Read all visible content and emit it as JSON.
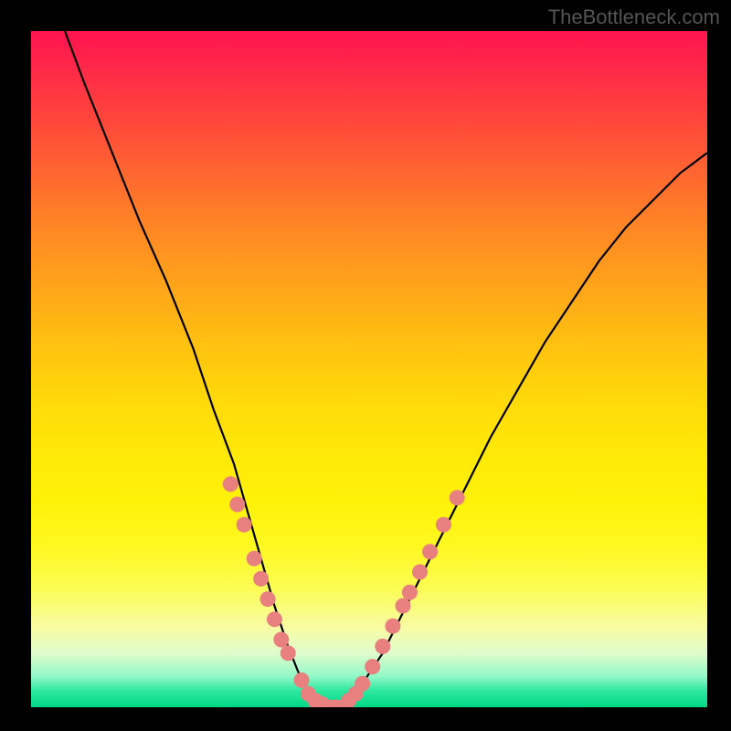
{
  "watermark": "TheBottleneck.com",
  "chart_data": {
    "type": "line",
    "title": "",
    "xlabel": "",
    "ylabel": "",
    "xlim": [
      0,
      100
    ],
    "ylim": [
      0,
      100
    ],
    "curve": {
      "name": "bottleneck-curve",
      "x": [
        5,
        8,
        12,
        16,
        20,
        24,
        27,
        30,
        32,
        34,
        36,
        38,
        40,
        42,
        44,
        46,
        48,
        52,
        56,
        60,
        64,
        68,
        72,
        76,
        80,
        84,
        88,
        92,
        96,
        100
      ],
      "y": [
        100,
        92,
        82,
        72,
        63,
        53,
        44,
        36,
        29,
        22,
        15,
        9,
        4,
        1,
        0,
        0,
        2,
        8,
        16,
        24,
        32,
        40,
        47,
        54,
        60,
        66,
        71,
        75,
        79,
        82
      ]
    },
    "dots": {
      "name": "highlighted-points",
      "color": "#e98080",
      "points": [
        {
          "x": 29.5,
          "y": 33
        },
        {
          "x": 30.5,
          "y": 30
        },
        {
          "x": 31.5,
          "y": 27
        },
        {
          "x": 33,
          "y": 22
        },
        {
          "x": 34,
          "y": 19
        },
        {
          "x": 35,
          "y": 16
        },
        {
          "x": 36,
          "y": 13
        },
        {
          "x": 37,
          "y": 10
        },
        {
          "x": 38,
          "y": 8
        },
        {
          "x": 40,
          "y": 4
        },
        {
          "x": 41,
          "y": 2
        },
        {
          "x": 42,
          "y": 1
        },
        {
          "x": 43,
          "y": 0.5
        },
        {
          "x": 44,
          "y": 0
        },
        {
          "x": 45,
          "y": 0
        },
        {
          "x": 46,
          "y": 0
        },
        {
          "x": 47,
          "y": 1
        },
        {
          "x": 48,
          "y": 2
        },
        {
          "x": 49,
          "y": 3.5
        },
        {
          "x": 50.5,
          "y": 6
        },
        {
          "x": 52,
          "y": 9
        },
        {
          "x": 53.5,
          "y": 12
        },
        {
          "x": 55,
          "y": 15
        },
        {
          "x": 56,
          "y": 17
        },
        {
          "x": 57.5,
          "y": 20
        },
        {
          "x": 59,
          "y": 23
        },
        {
          "x": 61,
          "y": 27
        },
        {
          "x": 63,
          "y": 31
        }
      ]
    },
    "gradient_stops": [
      {
        "pos": 0,
        "color": "#ff1450"
      },
      {
        "pos": 50,
        "color": "#ffd80a"
      },
      {
        "pos": 88,
        "color": "#f8fca0"
      },
      {
        "pos": 100,
        "color": "#00d884"
      }
    ]
  }
}
